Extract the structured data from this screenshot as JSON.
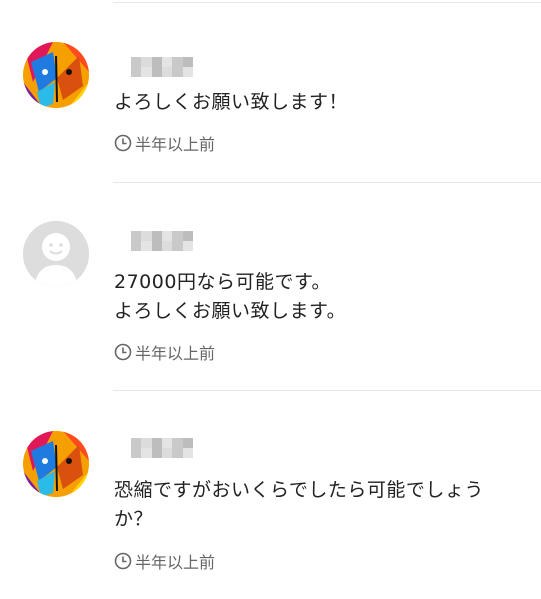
{
  "comments": [
    {
      "avatar": "butterfly-avatar",
      "name_hidden": true,
      "message": "よろしくお願い致します！",
      "time": "半年以上前"
    },
    {
      "avatar": "default-avatar",
      "name_hidden": true,
      "message": "27000円なら可能です。\nよろしくお願い致します。",
      "time": "半年以上前"
    },
    {
      "avatar": "butterfly-avatar",
      "name_hidden": true,
      "message": "恐縮ですがおいくらでしたら可能でしょう\nか？",
      "time": "半年以上前"
    }
  ],
  "colors": {
    "divider": "#e6e6e6",
    "text": "#222222",
    "meta": "#666666",
    "default_avatar_bg": "#dddddd"
  }
}
